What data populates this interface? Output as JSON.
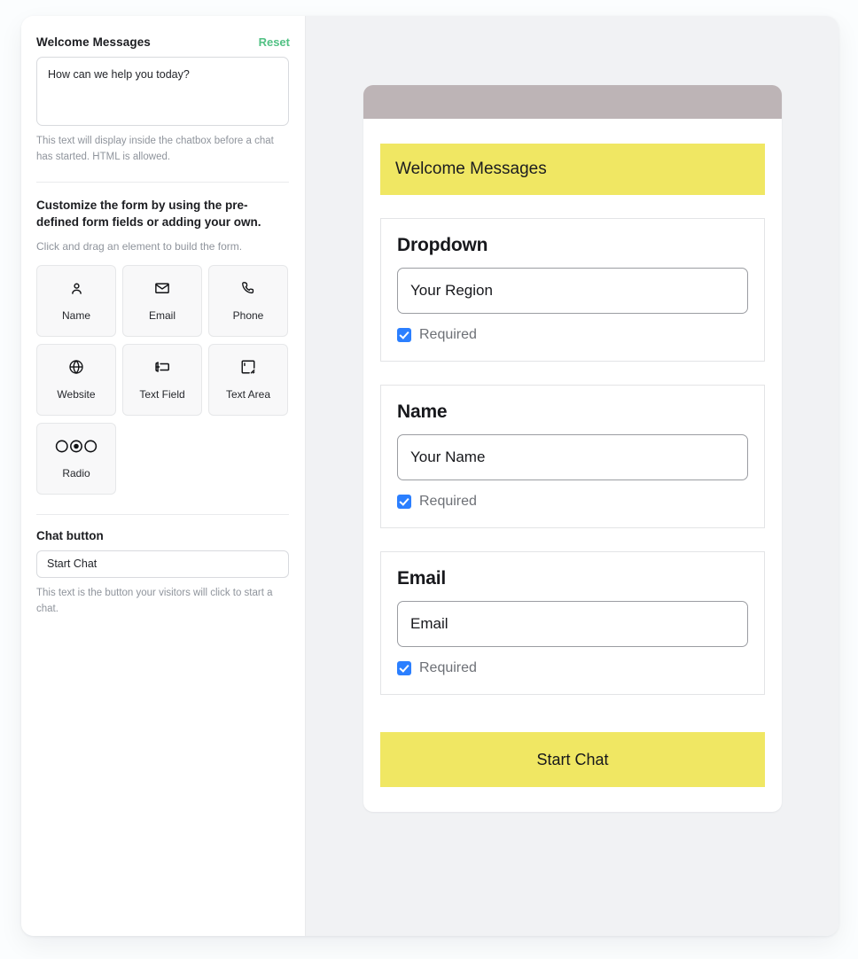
{
  "settings": {
    "welcome": {
      "title": "Welcome Messages",
      "reset_label": "Reset",
      "message_value": "How can we help you today?",
      "help_text": "This text will display inside the chatbox before a chat has started. HTML is allowed."
    },
    "builder": {
      "heading": "Customize the form by using the pre-defined form fields or adding your own.",
      "subtext": "Click and drag an element to build the form.",
      "fields": [
        {
          "label": "Name",
          "icon": "person-icon"
        },
        {
          "label": "Email",
          "icon": "envelope-icon"
        },
        {
          "label": "Phone",
          "icon": "phone-icon"
        },
        {
          "label": "Website",
          "icon": "globe-icon"
        },
        {
          "label": "Text Field",
          "icon": "text-field-icon"
        },
        {
          "label": "Text Area",
          "icon": "text-area-icon"
        },
        {
          "label": "Radio",
          "icon": "radio-group-icon"
        }
      ]
    },
    "chat_button": {
      "title": "Chat button",
      "value": "Start Chat",
      "help_text": "This text is the button your visitors will click to start a chat."
    }
  },
  "preview": {
    "welcome_banner": "Welcome Messages",
    "cards": [
      {
        "title": "Dropdown",
        "input_value": "Your Region",
        "required_label": "Required",
        "required_checked": true
      },
      {
        "title": "Name",
        "input_value": "Your Name",
        "required_label": "Required",
        "required_checked": true
      },
      {
        "title": "Email",
        "input_value": "Email",
        "required_label": "Required",
        "required_checked": true
      }
    ],
    "start_button_label": "Start Chat"
  },
  "colors": {
    "accent_yellow": "#f0e763",
    "reset_green": "#52c184",
    "checkbox_blue": "#2b7fff",
    "topbar_mauve": "#bdb4b6"
  }
}
